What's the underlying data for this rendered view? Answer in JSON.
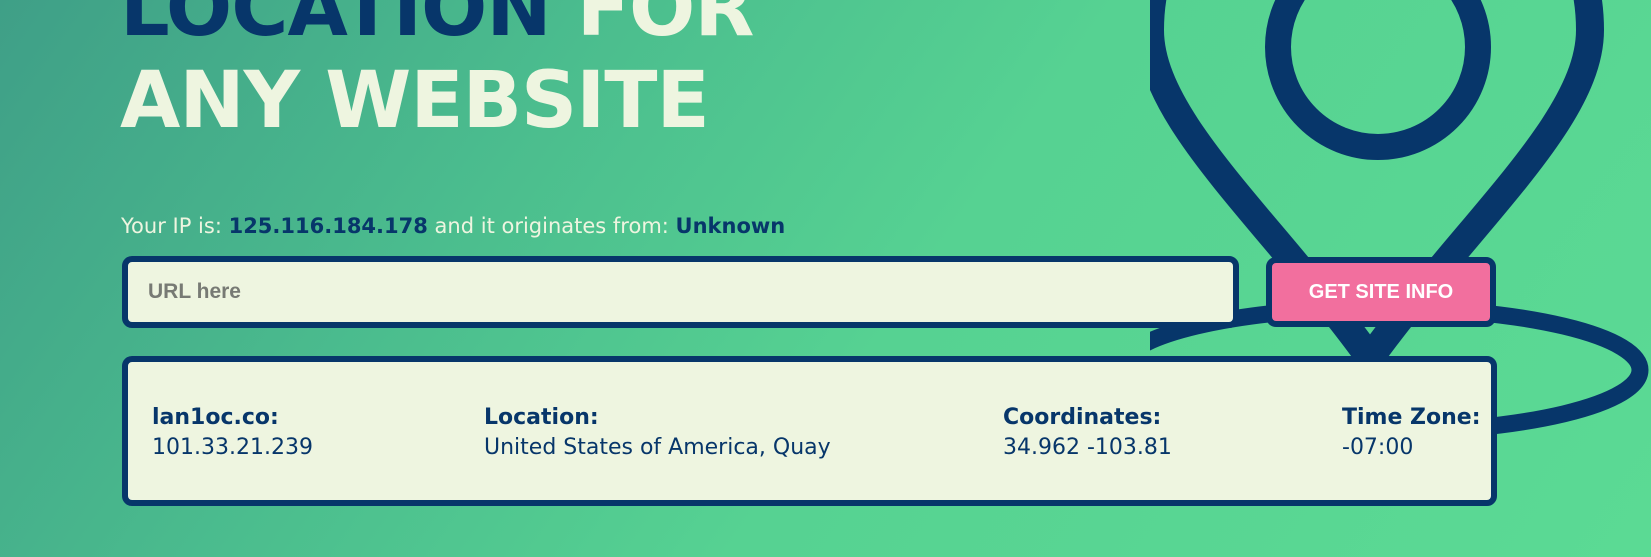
{
  "hero": {
    "line1_dark": "LOCATION",
    "line1_light": "FOR",
    "line2": "ANY WEBSITE"
  },
  "ip_info": {
    "prefix": "Your IP is:",
    "ip": "125.116.184.178",
    "middle": "and it originates from:",
    "origin": "Unknown"
  },
  "search": {
    "placeholder": "URL here",
    "value": "",
    "button_label": "GET SITE INFO"
  },
  "result": {
    "host_label": "lan1oc.co:",
    "host_value": "101.33.21.239",
    "location_label": "Location:",
    "location_value": "United States of America, Quay",
    "coords_label": "Coordinates:",
    "coords_value": "34.962 -103.81",
    "tz_label": "Time Zone:",
    "tz_value": "-07:00"
  },
  "icons": {
    "background": "map-pin-icon"
  },
  "colors": {
    "navy": "#07366a",
    "cream": "#eef5e0",
    "pink_button": "#f26f9e",
    "green_bg": "#56d292"
  }
}
